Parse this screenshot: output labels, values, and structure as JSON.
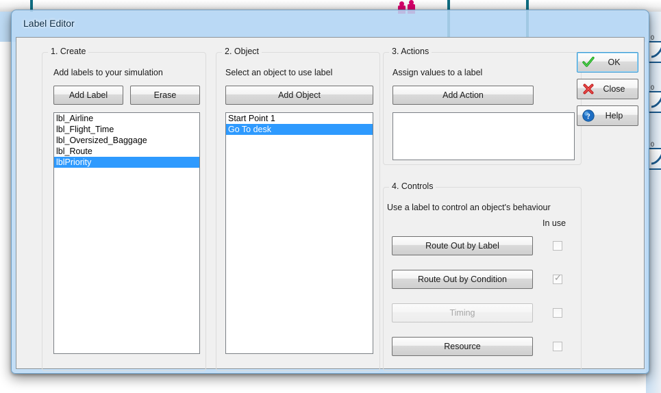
{
  "window": {
    "title": "Label Editor"
  },
  "sections": {
    "create": {
      "title": "1. Create",
      "description": "Add labels to your simulation",
      "add_label_button": "Add Label",
      "erase_button": "Erase",
      "labels": [
        {
          "text": "lbl_Airline",
          "selected": false
        },
        {
          "text": "lbl_Flight_Time",
          "selected": false
        },
        {
          "text": "lbl_Oversized_Baggage",
          "selected": false
        },
        {
          "text": "lbl_Route",
          "selected": false
        },
        {
          "text": "lblPriority",
          "selected": true
        }
      ]
    },
    "object": {
      "title": "2. Object",
      "description": "Select an object to use label",
      "add_object_button": "Add Object",
      "objects": [
        {
          "text": "Start Point 1",
          "selected": false
        },
        {
          "text": "Go To desk",
          "selected": true
        }
      ]
    },
    "actions": {
      "title": "3. Actions",
      "description": "Assign values to a label",
      "add_action_button": "Add Action",
      "action_items": []
    },
    "controls": {
      "title": "4. Controls",
      "description": "Use a label to control an object's behaviour",
      "in_use_header": "In use",
      "rows": [
        {
          "label": "Route Out by Label",
          "checked": false,
          "disabled": false
        },
        {
          "label": "Route Out by Condition",
          "checked": true,
          "disabled": false
        },
        {
          "label": "Timing",
          "checked": false,
          "disabled": true
        },
        {
          "label": "Resource",
          "checked": false,
          "disabled": false
        }
      ]
    }
  },
  "dialog_buttons": [
    {
      "label": "OK",
      "icon": "green-check-icon",
      "focused": true
    },
    {
      "label": "Close",
      "icon": "red-x-icon",
      "focused": false
    },
    {
      "label": "Help",
      "icon": "blue-question-icon",
      "focused": false
    }
  ],
  "background": {
    "markers": [
      "0",
      "0",
      "0"
    ],
    "accent_teal": "#0e6d82",
    "accent_pink": "#d4006a",
    "accent_blue": "#1b5a8e",
    "selection_blue": "#2e9afe"
  }
}
